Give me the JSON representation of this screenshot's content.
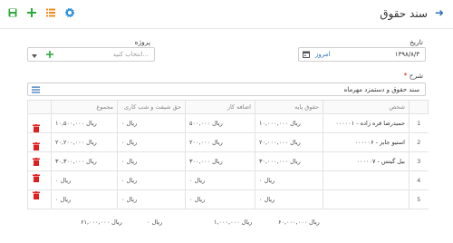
{
  "header": {
    "title": "سند حقوق"
  },
  "form": {
    "date_label": "تاریخ",
    "date_value": "۱۳۹۸/۸/۳",
    "today_label": "امروز",
    "project_label": "پروژه",
    "project_placeholder": "انتخاب کنید...",
    "desc_label": "شرح",
    "desc_required": "*",
    "desc_value": "سند حقوق و دستمزد مهرماه"
  },
  "table": {
    "columns": [
      "شخص",
      "حقوق پایه",
      "اضافه کار",
      "حق شیفت و شب کاری",
      "مجموع"
    ],
    "rows": [
      {
        "num": "1",
        "person": "۰۰۰۰۰۱ - حمیدرضا قره زاده",
        "base": "ریال ۱۰,۰۰۰,۰۰۰",
        "overtime": "ریال ۵۰۰,۰۰۰",
        "shift": "ریال ۰",
        "total": "ریال ۱۰,۵۰۰,۰۰۰"
      },
      {
        "num": "2",
        "person": "۰۰۰۰۰۶ - استیو جابز",
        "base": "ریال ۲۰,۰۰۰,۰۰۰",
        "overtime": "ریال ۲۰۰,۰۰۰",
        "shift": "ریال ۰",
        "total": "ریال ۲۰,۲۰۰,۰۰۰"
      },
      {
        "num": "3",
        "person": "۰۰۰۰۰۷ - بیل گیتس",
        "base": "ریال ۳۰,۰۰۰,۰۰۰",
        "overtime": "ریال ۳۰۰,۰۰۰",
        "shift": "ریال ۰",
        "total": "ریال ۳۰,۳۰۰,۰۰۰"
      },
      {
        "num": "4",
        "person": "",
        "base": "ریال ۰",
        "overtime": "ریال ۰",
        "shift": "ریال ۰",
        "total": "ریال ۰"
      },
      {
        "num": "5",
        "person": "",
        "base": "ریال ۰",
        "overtime": "ریال ۰",
        "shift": "ریال ۰",
        "total": "ریال ۰"
      }
    ],
    "totals": {
      "base": "ریال ۶۰,۰۰۰,۰۰۰",
      "overtime": "ریال ۱,۰۰۰,۰۰۰",
      "shift": "ریال ۰",
      "total": "ریال ۶۱,۰۰۰,۰۰۰"
    }
  },
  "icons": {
    "back": "arrow-right-icon",
    "save": "save-icon",
    "add": "plus-icon",
    "list": "list-icon",
    "settings": "gear-icon",
    "calendar": "calendar-icon",
    "delete": "trash-icon",
    "menu": "menu-icon"
  },
  "colors": {
    "primary": "#2a6fb8",
    "add": "#2eaa3c",
    "list": "#f08c1e",
    "delete": "#e02020",
    "save": "#2eaa3c"
  }
}
